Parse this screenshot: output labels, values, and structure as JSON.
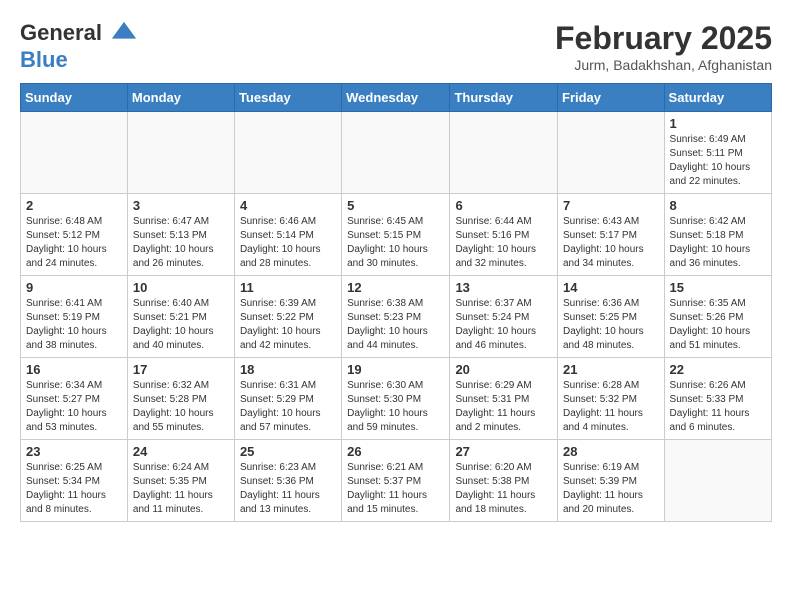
{
  "header": {
    "logo_line1": "General",
    "logo_line2": "Blue",
    "month_title": "February 2025",
    "location": "Jurm, Badakhshan, Afghanistan"
  },
  "weekdays": [
    "Sunday",
    "Monday",
    "Tuesday",
    "Wednesday",
    "Thursday",
    "Friday",
    "Saturday"
  ],
  "weeks": [
    [
      {
        "day": "",
        "info": ""
      },
      {
        "day": "",
        "info": ""
      },
      {
        "day": "",
        "info": ""
      },
      {
        "day": "",
        "info": ""
      },
      {
        "day": "",
        "info": ""
      },
      {
        "day": "",
        "info": ""
      },
      {
        "day": "1",
        "info": "Sunrise: 6:49 AM\nSunset: 5:11 PM\nDaylight: 10 hours and 22 minutes."
      }
    ],
    [
      {
        "day": "2",
        "info": "Sunrise: 6:48 AM\nSunset: 5:12 PM\nDaylight: 10 hours and 24 minutes."
      },
      {
        "day": "3",
        "info": "Sunrise: 6:47 AM\nSunset: 5:13 PM\nDaylight: 10 hours and 26 minutes."
      },
      {
        "day": "4",
        "info": "Sunrise: 6:46 AM\nSunset: 5:14 PM\nDaylight: 10 hours and 28 minutes."
      },
      {
        "day": "5",
        "info": "Sunrise: 6:45 AM\nSunset: 5:15 PM\nDaylight: 10 hours and 30 minutes."
      },
      {
        "day": "6",
        "info": "Sunrise: 6:44 AM\nSunset: 5:16 PM\nDaylight: 10 hours and 32 minutes."
      },
      {
        "day": "7",
        "info": "Sunrise: 6:43 AM\nSunset: 5:17 PM\nDaylight: 10 hours and 34 minutes."
      },
      {
        "day": "8",
        "info": "Sunrise: 6:42 AM\nSunset: 5:18 PM\nDaylight: 10 hours and 36 minutes."
      }
    ],
    [
      {
        "day": "9",
        "info": "Sunrise: 6:41 AM\nSunset: 5:19 PM\nDaylight: 10 hours and 38 minutes."
      },
      {
        "day": "10",
        "info": "Sunrise: 6:40 AM\nSunset: 5:21 PM\nDaylight: 10 hours and 40 minutes."
      },
      {
        "day": "11",
        "info": "Sunrise: 6:39 AM\nSunset: 5:22 PM\nDaylight: 10 hours and 42 minutes."
      },
      {
        "day": "12",
        "info": "Sunrise: 6:38 AM\nSunset: 5:23 PM\nDaylight: 10 hours and 44 minutes."
      },
      {
        "day": "13",
        "info": "Sunrise: 6:37 AM\nSunset: 5:24 PM\nDaylight: 10 hours and 46 minutes."
      },
      {
        "day": "14",
        "info": "Sunrise: 6:36 AM\nSunset: 5:25 PM\nDaylight: 10 hours and 48 minutes."
      },
      {
        "day": "15",
        "info": "Sunrise: 6:35 AM\nSunset: 5:26 PM\nDaylight: 10 hours and 51 minutes."
      }
    ],
    [
      {
        "day": "16",
        "info": "Sunrise: 6:34 AM\nSunset: 5:27 PM\nDaylight: 10 hours and 53 minutes."
      },
      {
        "day": "17",
        "info": "Sunrise: 6:32 AM\nSunset: 5:28 PM\nDaylight: 10 hours and 55 minutes."
      },
      {
        "day": "18",
        "info": "Sunrise: 6:31 AM\nSunset: 5:29 PM\nDaylight: 10 hours and 57 minutes."
      },
      {
        "day": "19",
        "info": "Sunrise: 6:30 AM\nSunset: 5:30 PM\nDaylight: 10 hours and 59 minutes."
      },
      {
        "day": "20",
        "info": "Sunrise: 6:29 AM\nSunset: 5:31 PM\nDaylight: 11 hours and 2 minutes."
      },
      {
        "day": "21",
        "info": "Sunrise: 6:28 AM\nSunset: 5:32 PM\nDaylight: 11 hours and 4 minutes."
      },
      {
        "day": "22",
        "info": "Sunrise: 6:26 AM\nSunset: 5:33 PM\nDaylight: 11 hours and 6 minutes."
      }
    ],
    [
      {
        "day": "23",
        "info": "Sunrise: 6:25 AM\nSunset: 5:34 PM\nDaylight: 11 hours and 8 minutes."
      },
      {
        "day": "24",
        "info": "Sunrise: 6:24 AM\nSunset: 5:35 PM\nDaylight: 11 hours and 11 minutes."
      },
      {
        "day": "25",
        "info": "Sunrise: 6:23 AM\nSunset: 5:36 PM\nDaylight: 11 hours and 13 minutes."
      },
      {
        "day": "26",
        "info": "Sunrise: 6:21 AM\nSunset: 5:37 PM\nDaylight: 11 hours and 15 minutes."
      },
      {
        "day": "27",
        "info": "Sunrise: 6:20 AM\nSunset: 5:38 PM\nDaylight: 11 hours and 18 minutes."
      },
      {
        "day": "28",
        "info": "Sunrise: 6:19 AM\nSunset: 5:39 PM\nDaylight: 11 hours and 20 minutes."
      },
      {
        "day": "",
        "info": ""
      }
    ]
  ]
}
